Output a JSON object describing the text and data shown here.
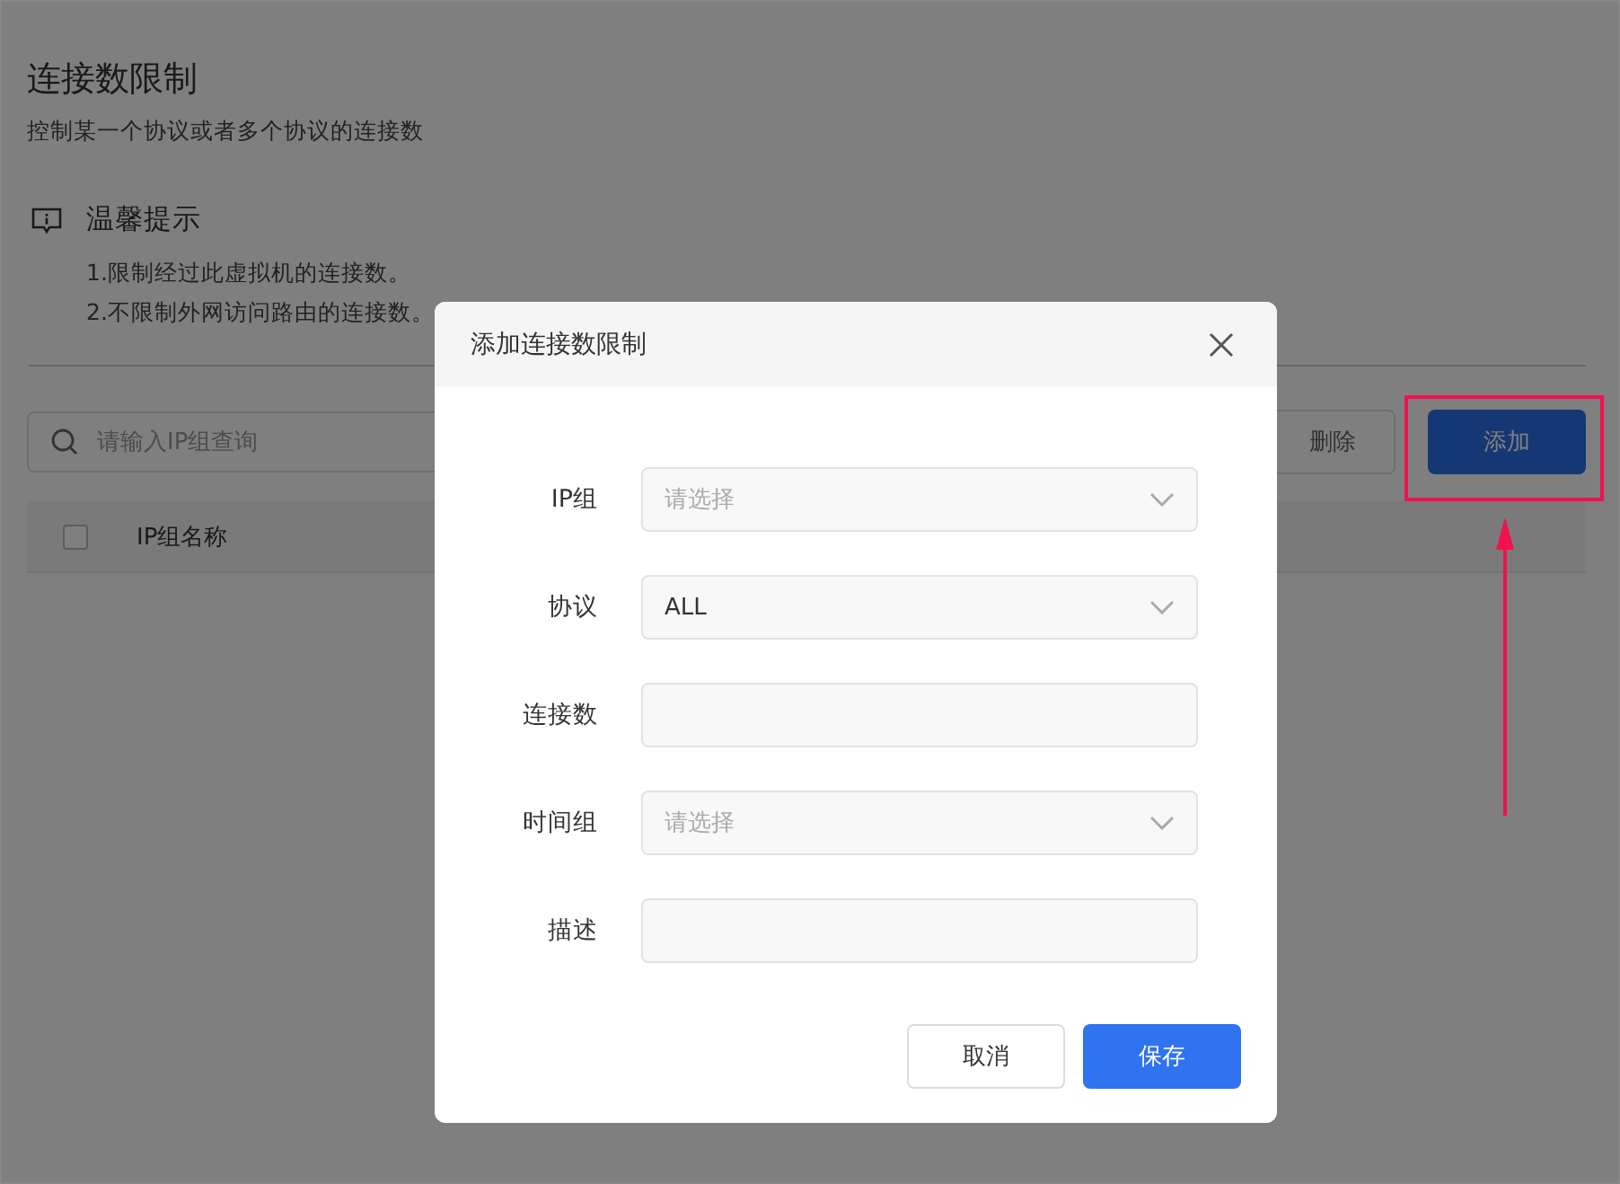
{
  "page": {
    "title": "连接数限制",
    "subtitle": "控制某一个协议或者多个协议的连接数",
    "tips": {
      "title": "温馨提示",
      "lines": [
        "1.限制经过此虚拟机的连接数。",
        "2.不限制外网访问路由的连接数。"
      ]
    },
    "search": {
      "placeholder": "请输入IP组查询"
    },
    "buttons": [
      {
        "label": "删除",
        "kind": "secondary"
      },
      {
        "label": "添加",
        "kind": "primary"
      }
    ],
    "table": {
      "select_all": {
        "checked": false
      },
      "columns": [
        {
          "label": "IP组名称"
        }
      ]
    }
  },
  "dialog": {
    "title": "添加连接数限制",
    "fields": [
      {
        "label": "IP组",
        "kind": "select",
        "placeholder": "请选择"
      },
      {
        "label": "协议",
        "kind": "select",
        "value": "ALL"
      },
      {
        "label": "连接数",
        "kind": "input"
      },
      {
        "label": "时间组",
        "kind": "select",
        "placeholder": "请选择"
      },
      {
        "label": "描述",
        "kind": "input"
      }
    ],
    "buttons": [
      {
        "label": "取消",
        "kind": "secondary"
      },
      {
        "label": "保存",
        "kind": "primary"
      }
    ]
  }
}
